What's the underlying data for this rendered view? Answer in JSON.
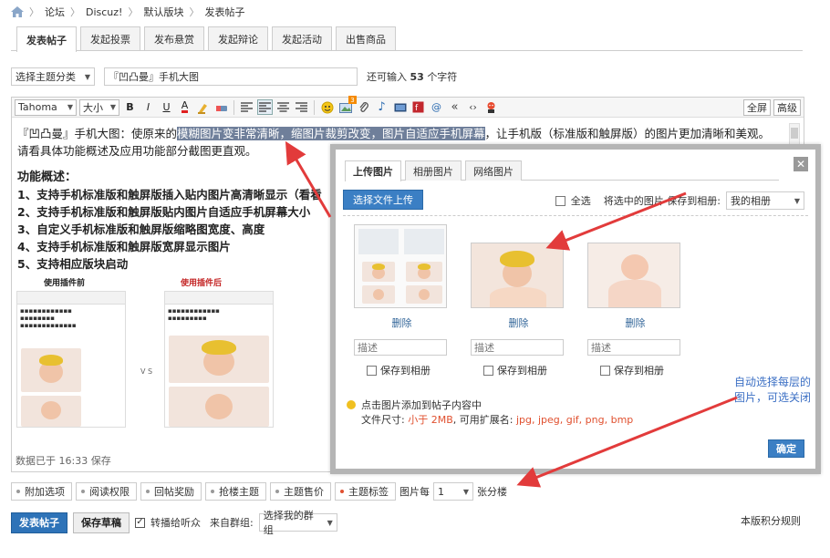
{
  "breadcrumb": {
    "home_icon": "home-icon",
    "items": [
      "论坛",
      "Discuz!",
      "默认版块",
      "发表帖子"
    ]
  },
  "tabs": [
    "发表帖子",
    "发起投票",
    "发布悬赏",
    "发起辩论",
    "发起活动",
    "出售商品"
  ],
  "subject": {
    "category_select": "选择主题分类",
    "title_value": "『凹凸曼』手机大图",
    "chars_prefix": "还可输入",
    "chars_remaining": "53",
    "chars_suffix": "个字符"
  },
  "editor": {
    "font_select": "Tahoma",
    "size_select": "大小",
    "fullscreen_label": "全屏",
    "advanced_label": "高级",
    "content": {
      "line1_prefix": "『凹凸曼』手机大图：使原来的",
      "line1_highlight": "模糊图片变非常清晰，缩图片裁剪改变，图片自适应手机屏幕",
      "line1_suffix": "，让手机版（标准版和触屏版）的图片更加清晰和美观。",
      "line2": "请看具体功能概述及应用功能部分截图更直观。",
      "features_title": "功能概述：",
      "features": [
        "1、支持手机标准版和触屏版插入贴内图片高清晰显示（看看",
        "2、支持手机标准版和触屏版贴内图片自适应手机屏幕大小",
        "3、自定义手机标准版和触屏版缩略图宽度、高度",
        "4、支持手机标准版和触屏版宽屏显示图片",
        "5、支持相应版块启动"
      ],
      "before_label": "使用插件前",
      "after_label": "使用插件后",
      "vs_label": "V S"
    },
    "draft_status": "数据已于 16:33 保存"
  },
  "dialog": {
    "tabs": [
      "上传图片",
      "相册图片",
      "网络图片"
    ],
    "upload_button": "选择文件上传",
    "select_all_label": "全选",
    "save_selected_label": "将选中的图片 保存到相册:",
    "album_select": "我的相册",
    "images": [
      {
        "delete_label": "删除",
        "desc_placeholder": "描述",
        "save_album_label": "保存到相册"
      },
      {
        "delete_label": "删除",
        "desc_placeholder": "描述",
        "save_album_label": "保存到相册"
      },
      {
        "delete_label": "删除",
        "desc_placeholder": "描述",
        "save_album_label": "保存到相册"
      }
    ],
    "tip": "点击图片添加到帖子内容中",
    "filesize_prefix": "文件尺寸:",
    "filesize_limit": "小于 2MB",
    "ext_prefix": ", 可用扩展名:",
    "extensions": "jpg, jpeg, gif, png, bmp",
    "confirm_label": "确定"
  },
  "annotation": {
    "line1": "自动选择每层的",
    "line2": "图片，可选关闭"
  },
  "options": {
    "items": [
      "附加选项",
      "阅读权限",
      "回帖奖励",
      "抢楼主题",
      "主题售价",
      "主题标签"
    ],
    "per_page_prefix": "图片每",
    "per_page_value": "1",
    "per_page_suffix": "张分楼"
  },
  "submit": {
    "publish_label": "发表帖子",
    "draft_label": "保存草稿",
    "broadcast_label": "转播给听众",
    "group_prefix": "来自群组:",
    "group_select": "选择我的群组"
  },
  "rules_link": "本版积分规则",
  "colors": {
    "primary_blue": "#2e73b8",
    "annotation_blue": "#3b6fc4",
    "arrow_red": "#e23b3b",
    "highlight": "#6f7f9a"
  }
}
